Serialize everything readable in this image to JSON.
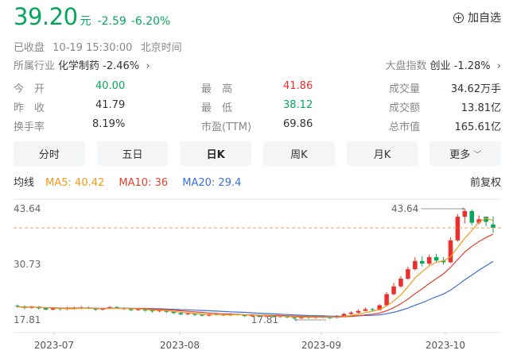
{
  "quote": {
    "price": "39.20",
    "unit": "元",
    "change": "-2.59",
    "change_pct": "-6.20%",
    "add_watchlist": "加自选",
    "status": "已收盘",
    "datetime": "10-19 15:30:00",
    "timezone": "北京时间"
  },
  "industry": {
    "label": "所属行业",
    "name": "化学制药",
    "change": "-2.46%",
    "index_label": "大盘指数",
    "index_name": "创业",
    "index_change": "-1.28%"
  },
  "stats": [
    {
      "label": "今　开",
      "value": "40.00",
      "color": "#07a75b"
    },
    {
      "label": "最　高",
      "value": "41.86",
      "color": "#e9302d"
    },
    {
      "label": "成交量",
      "value": "34.62万手",
      "color": "#333333"
    },
    {
      "label": "昨　收",
      "value": "41.79",
      "color": "#333333"
    },
    {
      "label": "最　低",
      "value": "38.12",
      "color": "#07a75b"
    },
    {
      "label": "成交额",
      "value": "13.81亿",
      "color": "#333333"
    },
    {
      "label": "换手率",
      "value": "8.19%",
      "color": "#333333"
    },
    {
      "label": "市盈(TTM)",
      "value": "69.86",
      "color": "#333333"
    },
    {
      "label": "总市值",
      "value": "165.61亿",
      "color": "#333333"
    }
  ],
  "tabs": [
    {
      "label": "分时"
    },
    {
      "label": "五日"
    },
    {
      "label": "日K"
    },
    {
      "label": "周K"
    },
    {
      "label": "月K"
    },
    {
      "label": "更多"
    }
  ],
  "active_tab": "日K",
  "ma": {
    "label": "均线",
    "ma5": "MA5: 40.42",
    "ma10": "MA10: 36",
    "ma20": "MA20: 29.4",
    "adjust": "前复权"
  },
  "colors": {
    "up": "#e9302d",
    "down": "#07a75b",
    "ma5": "#f19a1a",
    "ma10": "#e2412e",
    "ma20": "#3e6fd6"
  },
  "chart_data": {
    "type": "candlestick",
    "y_ticks": [
      "43.64",
      "30.73",
      "17.81"
    ],
    "x_ticks": [
      "2023-07",
      "2023-08",
      "2023-09",
      "2023-10"
    ],
    "high_marker": "43.64",
    "low_marker": "17.81",
    "current_price": 39.2,
    "ylim": [
      17.81,
      43.64
    ],
    "candles": [
      {
        "o": 21.1,
        "c": 20.9,
        "h": 21.4,
        "l": 20.6
      },
      {
        "o": 20.9,
        "c": 20.6,
        "h": 21.2,
        "l": 20.3
      },
      {
        "o": 20.6,
        "c": 20.9,
        "h": 21.1,
        "l": 20.4
      },
      {
        "o": 20.9,
        "c": 20.5,
        "h": 21.0,
        "l": 20.2
      },
      {
        "o": 20.5,
        "c": 20.2,
        "h": 20.8,
        "l": 20.0
      },
      {
        "o": 20.2,
        "c": 20.5,
        "h": 20.7,
        "l": 20.0
      },
      {
        "o": 20.5,
        "c": 20.3,
        "h": 20.6,
        "l": 20.0
      },
      {
        "o": 20.3,
        "c": 20.6,
        "h": 20.8,
        "l": 20.1
      },
      {
        "o": 20.6,
        "c": 20.4,
        "h": 20.9,
        "l": 20.2
      },
      {
        "o": 20.4,
        "c": 20.7,
        "h": 21.0,
        "l": 20.3
      },
      {
        "o": 20.7,
        "c": 20.5,
        "h": 20.9,
        "l": 20.3
      },
      {
        "o": 20.5,
        "c": 20.2,
        "h": 20.7,
        "l": 19.9
      },
      {
        "o": 20.2,
        "c": 20.4,
        "h": 20.6,
        "l": 20.0
      },
      {
        "o": 20.4,
        "c": 20.8,
        "h": 21.0,
        "l": 20.3
      },
      {
        "o": 20.8,
        "c": 20.6,
        "h": 21.0,
        "l": 20.4
      },
      {
        "o": 20.6,
        "c": 20.3,
        "h": 20.8,
        "l": 20.1
      },
      {
        "o": 20.3,
        "c": 20.1,
        "h": 20.5,
        "l": 19.8
      },
      {
        "o": 20.1,
        "c": 20.3,
        "h": 20.5,
        "l": 19.9
      },
      {
        "o": 20.3,
        "c": 20.0,
        "h": 20.4,
        "l": 19.7
      },
      {
        "o": 20.0,
        "c": 19.8,
        "h": 20.2,
        "l": 19.5
      },
      {
        "o": 19.8,
        "c": 20.0,
        "h": 20.2,
        "l": 19.6
      },
      {
        "o": 20.0,
        "c": 19.7,
        "h": 20.1,
        "l": 19.4
      },
      {
        "o": 19.7,
        "c": 19.4,
        "h": 19.9,
        "l": 19.2
      },
      {
        "o": 19.4,
        "c": 19.1,
        "h": 19.6,
        "l": 18.9
      },
      {
        "o": 19.1,
        "c": 19.3,
        "h": 19.5,
        "l": 18.9
      },
      {
        "o": 19.3,
        "c": 19.0,
        "h": 19.4,
        "l": 18.7
      },
      {
        "o": 19.0,
        "c": 18.8,
        "h": 19.2,
        "l": 18.6
      },
      {
        "o": 18.8,
        "c": 19.1,
        "h": 19.3,
        "l": 18.6
      },
      {
        "o": 19.1,
        "c": 19.0,
        "h": 19.3,
        "l": 18.8
      },
      {
        "o": 19.0,
        "c": 18.9,
        "h": 19.2,
        "l": 18.7
      },
      {
        "o": 18.9,
        "c": 19.2,
        "h": 19.4,
        "l": 18.7
      },
      {
        "o": 19.2,
        "c": 19.0,
        "h": 19.3,
        "l": 18.8
      },
      {
        "o": 19.0,
        "c": 18.7,
        "h": 19.1,
        "l": 18.5
      },
      {
        "o": 18.7,
        "c": 18.9,
        "h": 19.1,
        "l": 18.5
      },
      {
        "o": 18.9,
        "c": 18.6,
        "h": 19.0,
        "l": 18.4
      },
      {
        "o": 18.6,
        "c": 18.8,
        "h": 19.0,
        "l": 18.4
      },
      {
        "o": 18.8,
        "c": 18.5,
        "h": 18.9,
        "l": 18.3
      },
      {
        "o": 18.5,
        "c": 18.7,
        "h": 18.9,
        "l": 18.3
      },
      {
        "o": 18.7,
        "c": 18.4,
        "h": 18.8,
        "l": 18.2
      },
      {
        "o": 18.4,
        "c": 18.2,
        "h": 18.6,
        "l": 17.81
      },
      {
        "o": 18.2,
        "c": 18.5,
        "h": 18.7,
        "l": 18.0
      },
      {
        "o": 18.5,
        "c": 18.3,
        "h": 18.7,
        "l": 18.1
      },
      {
        "o": 18.3,
        "c": 18.6,
        "h": 18.8,
        "l": 18.1
      },
      {
        "o": 18.6,
        "c": 18.4,
        "h": 18.8,
        "l": 18.2
      },
      {
        "o": 18.4,
        "c": 18.3,
        "h": 18.6,
        "l": 18.0
      },
      {
        "o": 18.3,
        "c": 18.7,
        "h": 18.9,
        "l": 18.2
      },
      {
        "o": 18.7,
        "c": 19.2,
        "h": 19.4,
        "l": 18.6
      },
      {
        "o": 19.2,
        "c": 19.5,
        "h": 19.8,
        "l": 19.0
      },
      {
        "o": 19.5,
        "c": 19.9,
        "h": 20.2,
        "l": 19.3
      },
      {
        "o": 19.9,
        "c": 20.3,
        "h": 20.7,
        "l": 19.8
      },
      {
        "o": 20.3,
        "c": 20.1,
        "h": 20.6,
        "l": 19.9
      },
      {
        "o": 20.1,
        "c": 21.2,
        "h": 21.5,
        "l": 20.0
      },
      {
        "o": 21.2,
        "c": 23.8,
        "h": 24.3,
        "l": 21.0
      },
      {
        "o": 23.8,
        "c": 25.6,
        "h": 26.4,
        "l": 23.5
      },
      {
        "o": 25.6,
        "c": 27.4,
        "h": 28.0,
        "l": 25.3
      },
      {
        "o": 27.4,
        "c": 29.6,
        "h": 30.2,
        "l": 27.1
      },
      {
        "o": 29.6,
        "c": 31.5,
        "h": 32.4,
        "l": 29.3
      },
      {
        "o": 31.5,
        "c": 30.9,
        "h": 32.6,
        "l": 30.2
      },
      {
        "o": 30.9,
        "c": 32.4,
        "h": 33.0,
        "l": 30.5
      },
      {
        "o": 32.4,
        "c": 31.6,
        "h": 33.2,
        "l": 31.1
      },
      {
        "o": 31.6,
        "c": 31.2,
        "h": 32.4,
        "l": 30.7
      },
      {
        "o": 31.2,
        "c": 36.3,
        "h": 37.0,
        "l": 31.0
      },
      {
        "o": 36.3,
        "c": 41.8,
        "h": 42.4,
        "l": 36.0
      },
      {
        "o": 41.8,
        "c": 43.1,
        "h": 43.64,
        "l": 40.2
      },
      {
        "o": 43.1,
        "c": 40.4,
        "h": 43.5,
        "l": 39.8
      },
      {
        "o": 40.4,
        "c": 41.2,
        "h": 42.1,
        "l": 40.0
      },
      {
        "o": 41.79,
        "c": 40.6,
        "h": 41.86,
        "l": 39.6
      },
      {
        "o": 40.0,
        "c": 39.2,
        "h": 41.86,
        "l": 38.12
      }
    ]
  }
}
